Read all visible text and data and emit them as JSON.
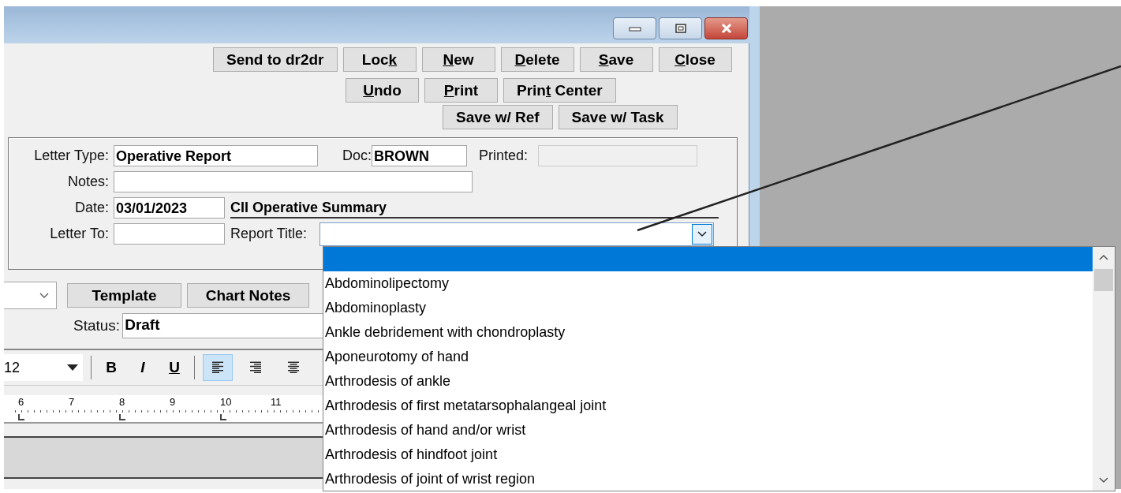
{
  "toolbar_rows": [
    [
      {
        "parts": [
          {
            "text": "Send to dr2dr",
            "accelerator": false
          }
        ]
      },
      {
        "parts": [
          {
            "text": "Loc",
            "accelerator": false
          },
          {
            "text": "k",
            "accelerator": true
          }
        ]
      },
      {
        "parts": [
          {
            "text": "N",
            "accelerator": true
          },
          {
            "text": "ew",
            "accelerator": false
          }
        ]
      },
      {
        "parts": [
          {
            "text": "D",
            "accelerator": true
          },
          {
            "text": "elete",
            "accelerator": false
          }
        ]
      },
      {
        "parts": [
          {
            "text": "S",
            "accelerator": true
          },
          {
            "text": "ave",
            "accelerator": false
          }
        ]
      },
      {
        "parts": [
          {
            "text": "C",
            "accelerator": true
          },
          {
            "text": "lose",
            "accelerator": false
          }
        ]
      }
    ],
    [
      {
        "parts": [
          {
            "text": "U",
            "accelerator": true
          },
          {
            "text": "ndo",
            "accelerator": false
          }
        ]
      },
      {
        "parts": [
          {
            "text": "P",
            "accelerator": true
          },
          {
            "text": "rint",
            "accelerator": false
          }
        ]
      },
      {
        "parts": [
          {
            "text": "Prin",
            "accelerator": false
          },
          {
            "text": "t",
            "accelerator": true
          },
          {
            "text": " Center",
            "accelerator": false
          }
        ]
      }
    ],
    [
      {
        "parts": [
          {
            "text": "Save w/ Ref",
            "accelerator": false
          }
        ]
      },
      {
        "parts": [
          {
            "text": "Save w/ Task",
            "accelerator": false
          }
        ]
      }
    ]
  ],
  "form": {
    "letter_type": {
      "label": "Letter Type:",
      "value": "Operative Report"
    },
    "doc": {
      "label": "Doc:",
      "value": "BROWN"
    },
    "printed": {
      "label": "Printed:",
      "disabled": true
    },
    "notes": {
      "label": "Notes:"
    },
    "date": {
      "label": "Date:",
      "value": "03/01/2023"
    },
    "summary_heading": "CII Operative Summary",
    "letter_to": {
      "label": "Letter To:"
    },
    "report_title": {
      "label": "Report Title:",
      "expanded": true
    }
  },
  "action_buttons": [
    "Template",
    "Chart Notes"
  ],
  "status": {
    "label": "Status:",
    "value": "Draft"
  },
  "format_bar": {
    "font_size": "12",
    "styles": [
      "B",
      "I",
      "U"
    ],
    "alignments": [
      {
        "kind": "left",
        "selected": true
      },
      {
        "kind": "right",
        "selected": false
      },
      {
        "kind": "center",
        "selected": false
      }
    ]
  },
  "ruler": {
    "marks": [
      "6",
      "7",
      "8",
      "9",
      "10",
      "11"
    ]
  },
  "dropdown_items": [
    {
      "selected": true
    },
    {
      "label": "Abdominolipectomy",
      "selected": false
    },
    {
      "label": "Abdominoplasty",
      "selected": false
    },
    {
      "label": "Ankle debridement with chondroplasty",
      "selected": false
    },
    {
      "label": "Aponeurotomy of hand",
      "selected": false
    },
    {
      "label": "Arthrodesis of ankle",
      "selected": false
    },
    {
      "label": "Arthrodesis of first metatarsophalangeal joint",
      "selected": false
    },
    {
      "label": "Arthrodesis of hand and/or wrist",
      "selected": false
    },
    {
      "label": "Arthrodesis of hindfoot joint",
      "selected": false
    },
    {
      "label": "Arthrodesis of joint of wrist region",
      "selected": false
    }
  ]
}
